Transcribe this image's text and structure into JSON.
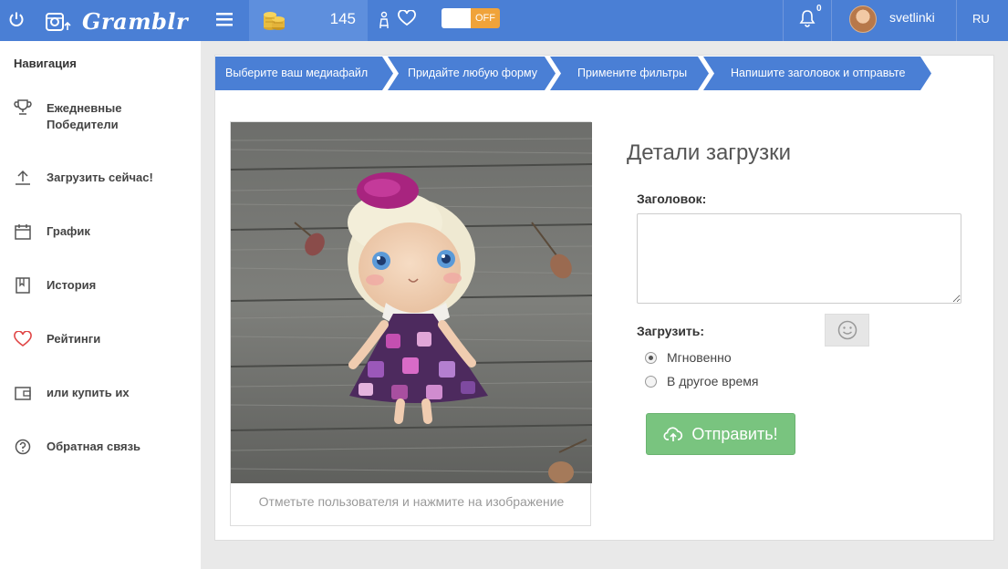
{
  "header": {
    "logo_text": "Gramblr",
    "coins": "145",
    "toggle_state": "OFF",
    "notification_count": "0",
    "username": "svetlinki",
    "language": "RU"
  },
  "sidebar": {
    "heading": "Навигация",
    "items": [
      {
        "label": "Ежедневные Победители",
        "icon": "trophy-icon"
      },
      {
        "label": "Загрузить сейчас!",
        "icon": "upload-icon"
      },
      {
        "label": "График",
        "icon": "calendar-icon"
      },
      {
        "label": "История",
        "icon": "book-icon"
      },
      {
        "label": "Рейтинги",
        "icon": "heart-icon"
      },
      {
        "label": "или купить их",
        "icon": "wallet-icon"
      },
      {
        "label": "Обратная связь",
        "icon": "help-icon"
      }
    ]
  },
  "steps": [
    "Выберите ваш медиафайл",
    "Придайте любую форму",
    "Примените фильтры",
    "Напишите заголовок и отправьте"
  ],
  "upload": {
    "photo_caption": "Отметьте пользователя и нажмите на изображение",
    "details_title": "Детали загрузки",
    "caption_label": "Заголовок:",
    "caption_value": "",
    "schedule_label": "Загрузить:",
    "options": [
      "Мгновенно",
      "В другое время"
    ],
    "selected_option": "Мгновенно",
    "submit_label": "Отправить!"
  },
  "colors": {
    "topbar": "#4a7fd5",
    "step": "#4a7fd5",
    "toggle_off": "#f0a33a",
    "submit": "#79c47f",
    "heart": "#e04545"
  }
}
